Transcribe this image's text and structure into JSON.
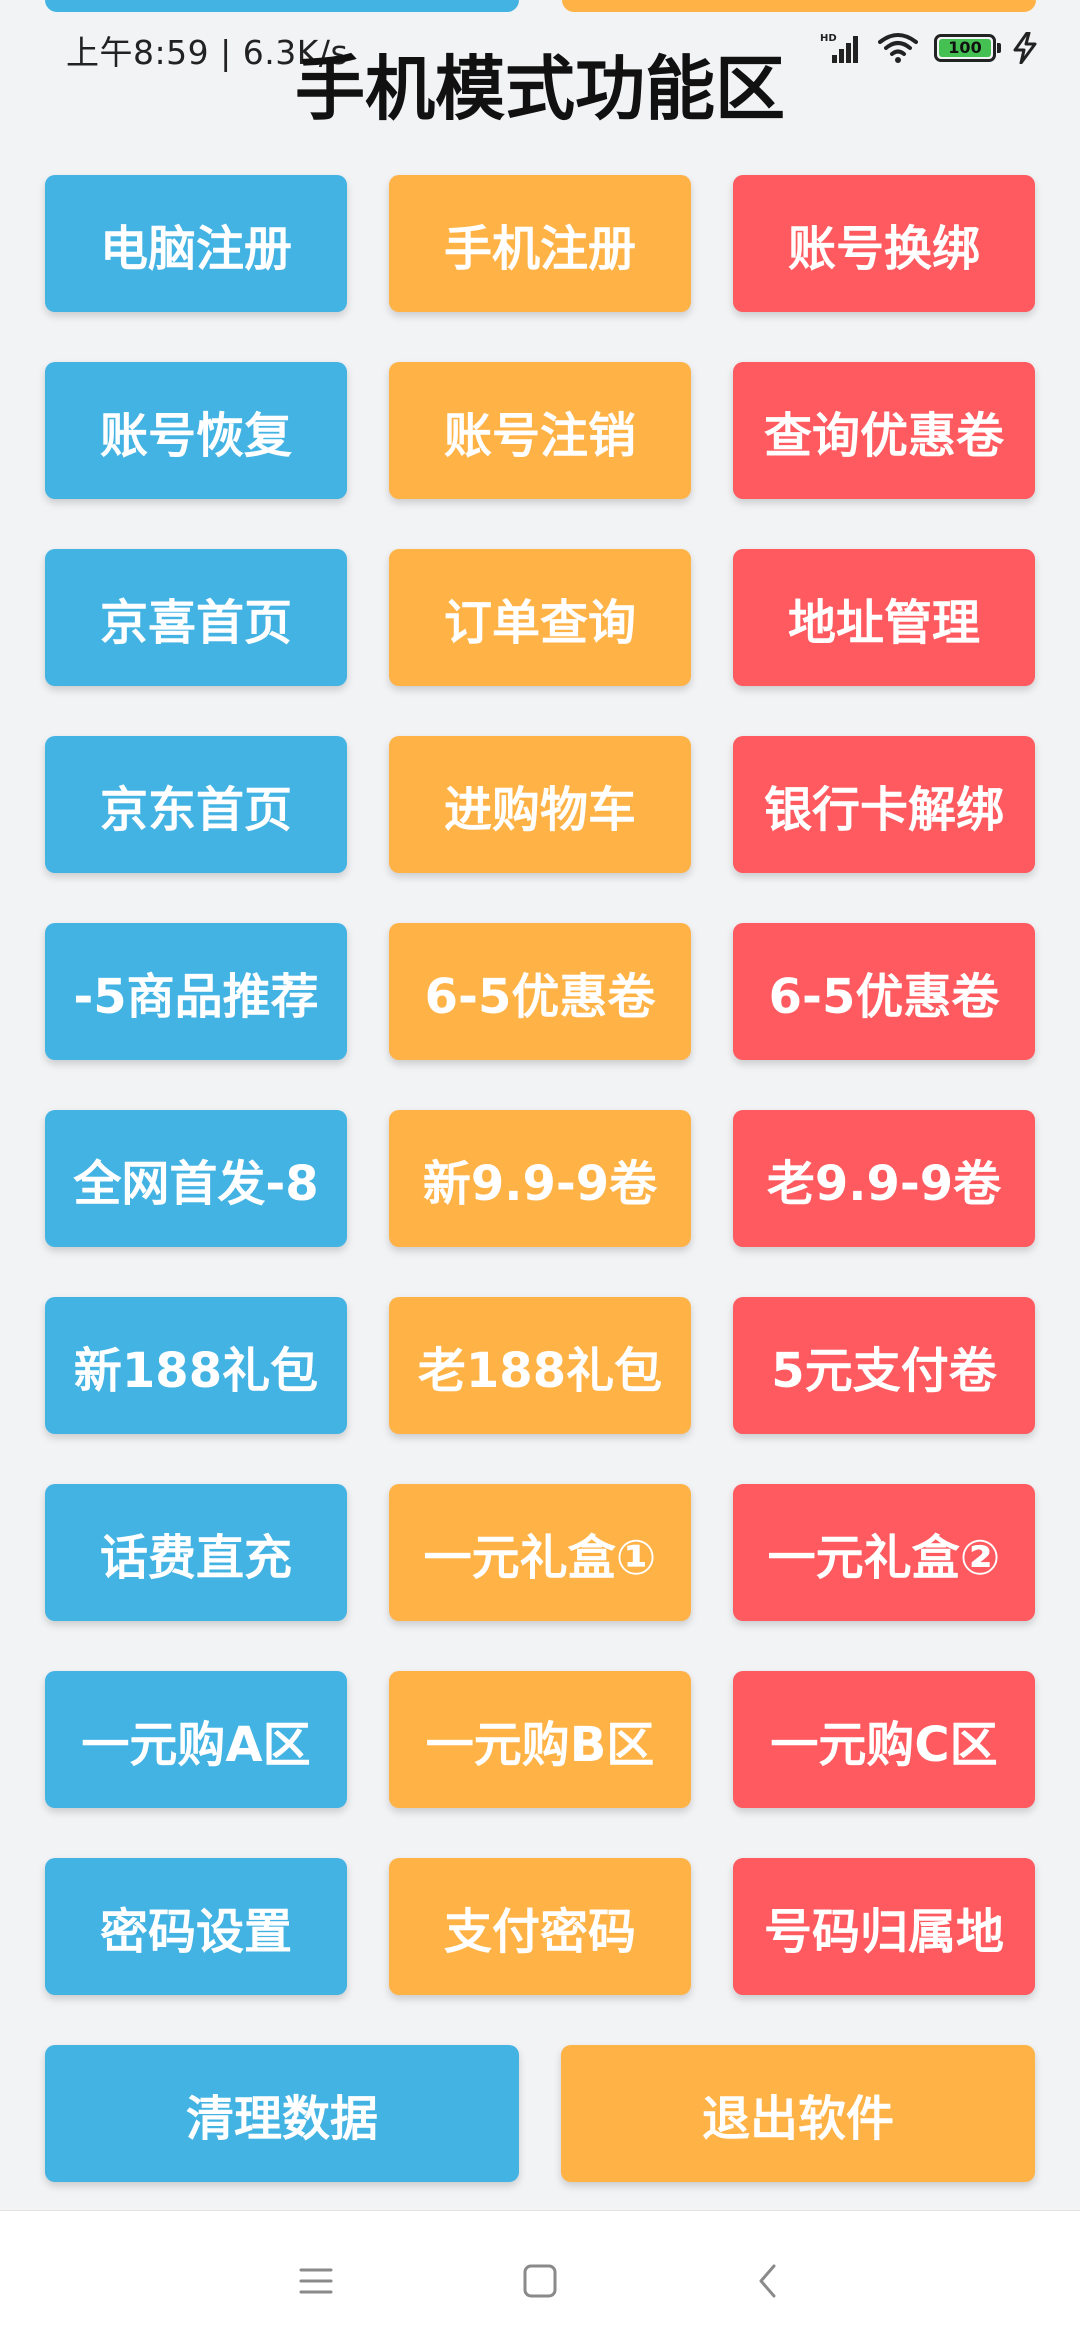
{
  "status_bar": {
    "time": "上午8:59",
    "separator": "|",
    "net_speed": "6.3K/s",
    "hd_label": "HD",
    "battery_level": "100",
    "icons": [
      "hd-signal-icon",
      "wifi-icon",
      "battery-icon",
      "charging-icon"
    ]
  },
  "title": "手机模式功能区",
  "colors": {
    "blue": "#43b3e3",
    "orange": "#ffb347",
    "red": "#fe5a5f",
    "background": "#f2f3f5"
  },
  "rows": [
    {
      "buttons": [
        {
          "label": "电脑注册",
          "color": "blue"
        },
        {
          "label": "手机注册",
          "color": "orange"
        },
        {
          "label": "账号换绑",
          "color": "red"
        }
      ]
    },
    {
      "buttons": [
        {
          "label": "账号恢复",
          "color": "blue"
        },
        {
          "label": "账号注销",
          "color": "orange"
        },
        {
          "label": "查询优惠卷",
          "color": "red"
        }
      ]
    },
    {
      "buttons": [
        {
          "label": "京喜首页",
          "color": "blue"
        },
        {
          "label": "订单查询",
          "color": "orange"
        },
        {
          "label": "地址管理",
          "color": "red"
        }
      ]
    },
    {
      "buttons": [
        {
          "label": "京东首页",
          "color": "blue"
        },
        {
          "label": "进购物车",
          "color": "orange"
        },
        {
          "label": "银行卡解绑",
          "color": "red"
        }
      ]
    },
    {
      "buttons": [
        {
          "label": "-5商品推荐",
          "color": "blue"
        },
        {
          "label": "6-5优惠卷",
          "color": "orange"
        },
        {
          "label": "6-5优惠卷",
          "color": "red"
        }
      ]
    },
    {
      "buttons": [
        {
          "label": "全网首发-8",
          "color": "blue"
        },
        {
          "label": "新9.9-9卷",
          "color": "orange"
        },
        {
          "label": "老9.9-9卷",
          "color": "red"
        }
      ]
    },
    {
      "buttons": [
        {
          "label": "新188礼包",
          "color": "blue"
        },
        {
          "label": "老188礼包",
          "color": "orange"
        },
        {
          "label": "5元支付卷",
          "color": "red"
        }
      ]
    },
    {
      "buttons": [
        {
          "label": "话费直充",
          "color": "blue"
        },
        {
          "label": "一元礼盒①",
          "color": "orange"
        },
        {
          "label": "一元礼盒②",
          "color": "red"
        }
      ]
    },
    {
      "buttons": [
        {
          "label": "一元购A区",
          "color": "blue"
        },
        {
          "label": "一元购B区",
          "color": "orange"
        },
        {
          "label": "一元购C区",
          "color": "red"
        }
      ]
    },
    {
      "buttons": [
        {
          "label": "密码设置",
          "color": "blue"
        },
        {
          "label": "支付密码",
          "color": "orange"
        },
        {
          "label": "号码归属地",
          "color": "red"
        }
      ]
    }
  ],
  "bottom": {
    "clear_label": "清理数据",
    "exit_label": "退出软件"
  },
  "nav": {
    "items": [
      "menu-icon",
      "home-icon",
      "back-icon"
    ]
  }
}
